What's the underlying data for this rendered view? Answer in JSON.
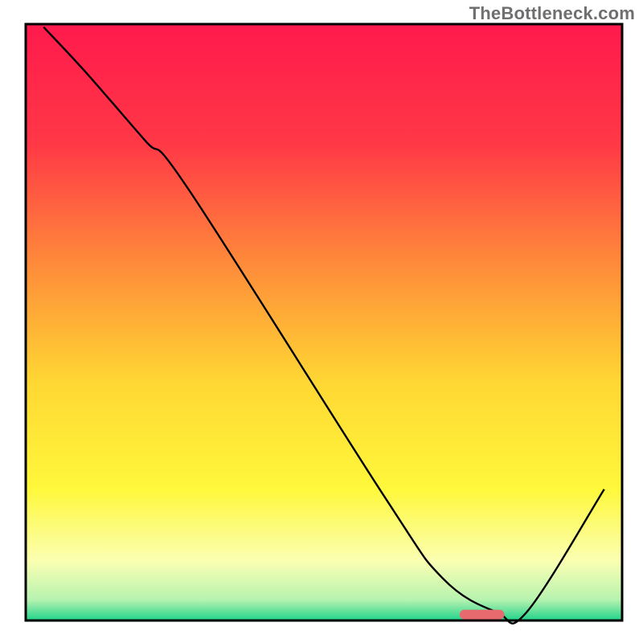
{
  "watermark": "TheBottleneck.com",
  "chart_data": {
    "type": "line",
    "title": "",
    "xlabel": "",
    "ylabel": "",
    "xlim": [
      0,
      100
    ],
    "ylim": [
      0,
      100
    ],
    "background_gradient": {
      "stops": [
        {
          "offset": 0.0,
          "color": "#ff1a4d"
        },
        {
          "offset": 0.2,
          "color": "#ff3846"
        },
        {
          "offset": 0.4,
          "color": "#ff8a3a"
        },
        {
          "offset": 0.6,
          "color": "#ffd733"
        },
        {
          "offset": 0.78,
          "color": "#fff83b"
        },
        {
          "offset": 0.9,
          "color": "#fbffb2"
        },
        {
          "offset": 0.965,
          "color": "#b7f3b0"
        },
        {
          "offset": 1.0,
          "color": "#20d38a"
        }
      ]
    },
    "series": [
      {
        "name": "bottleneck-curve",
        "x": [
          3.0,
          10.0,
          20.0,
          27.5,
          60.0,
          70.0,
          79.0,
          84.0,
          97.0
        ],
        "y": [
          99.5,
          92.0,
          80.5,
          72.0,
          21.0,
          7.0,
          1.4,
          1.4,
          22.0
        ]
      }
    ],
    "marker": {
      "name": "optimal-range",
      "x": 76.5,
      "y": 1.0,
      "width": 7.5,
      "height": 1.6,
      "color": "#e76a6e"
    },
    "frame_color": "#000000",
    "curve_color": "#000000"
  }
}
